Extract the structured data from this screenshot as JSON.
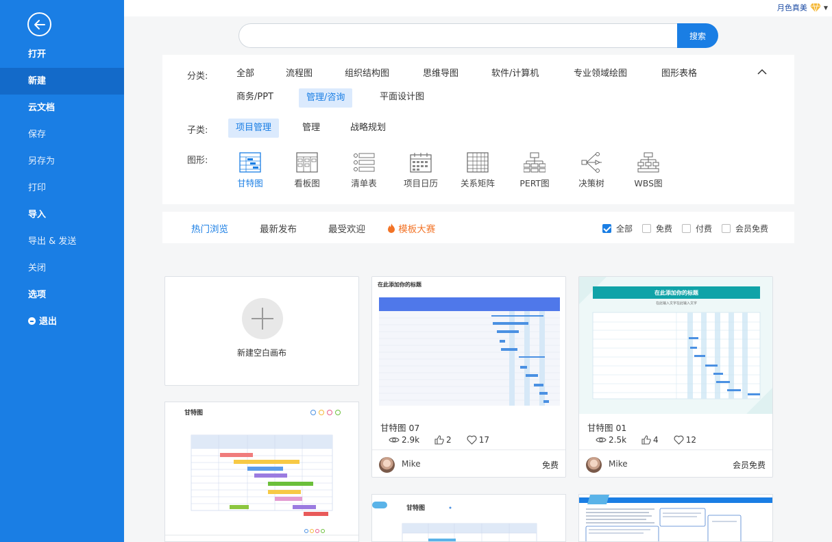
{
  "sidebar": {
    "items": [
      {
        "label": "打开",
        "style": "bold"
      },
      {
        "label": "新建",
        "style": "bold",
        "active": true
      },
      {
        "label": "云文档",
        "style": "bold"
      },
      {
        "label": "保存",
        "style": "light"
      },
      {
        "label": "另存为",
        "style": "light"
      },
      {
        "label": "打印",
        "style": "light"
      },
      {
        "label": "导入",
        "style": "bold"
      },
      {
        "label": "导出 & 发送",
        "style": "light"
      },
      {
        "label": "关闭",
        "style": "light"
      },
      {
        "label": "选项",
        "style": "bold"
      },
      {
        "label": "退出",
        "style": "bold"
      }
    ]
  },
  "user": {
    "name": "月色真美"
  },
  "search": {
    "value": "",
    "button": "搜索"
  },
  "filter": {
    "category_label": "分类:",
    "categories": [
      "全部",
      "流程图",
      "组织结构图",
      "思维导图",
      "软件/计算机",
      "专业领域绘图",
      "图形表格",
      "商务/PPT",
      "管理/咨询",
      "平面设计图"
    ],
    "subcategory_label": "子类:",
    "subcategories": [
      "项目管理",
      "管理",
      "战略规划"
    ],
    "shape_label": "图形:",
    "shapes": [
      "甘特图",
      "看板图",
      "清单表",
      "项目日历",
      "关系矩阵",
      "PERT图",
      "决策树",
      "WBS图"
    ]
  },
  "tabs": [
    "热门浏览",
    "最新发布",
    "最受欢迎",
    "模板大赛"
  ],
  "checks": [
    "全部",
    "免费",
    "付费",
    "会员免费"
  ],
  "blank": {
    "label": "新建空白画布"
  },
  "templates": [
    {
      "name": "甘特图 07",
      "views": "2.9k",
      "likes": "2",
      "favs": "17",
      "author": "Mike",
      "price": "免费",
      "thumb_title": "在此添加你的标题"
    },
    {
      "name": "甘特图 01",
      "views": "2.5k",
      "likes": "4",
      "favs": "12",
      "author": "Mike",
      "price": "会员免费",
      "thumb_title": "在此添加你的标题",
      "thumb_subtitle": "在此输入文字在此输入文字"
    }
  ],
  "bottom_cards": [
    {
      "title": "甘特图"
    },
    {
      "title": "甘特图"
    }
  ],
  "colors": {
    "primary": "#1a7ee4",
    "sidebar_active": "#136ac9",
    "accent_orange": "#f27326",
    "teal": "#10a3a8"
  }
}
